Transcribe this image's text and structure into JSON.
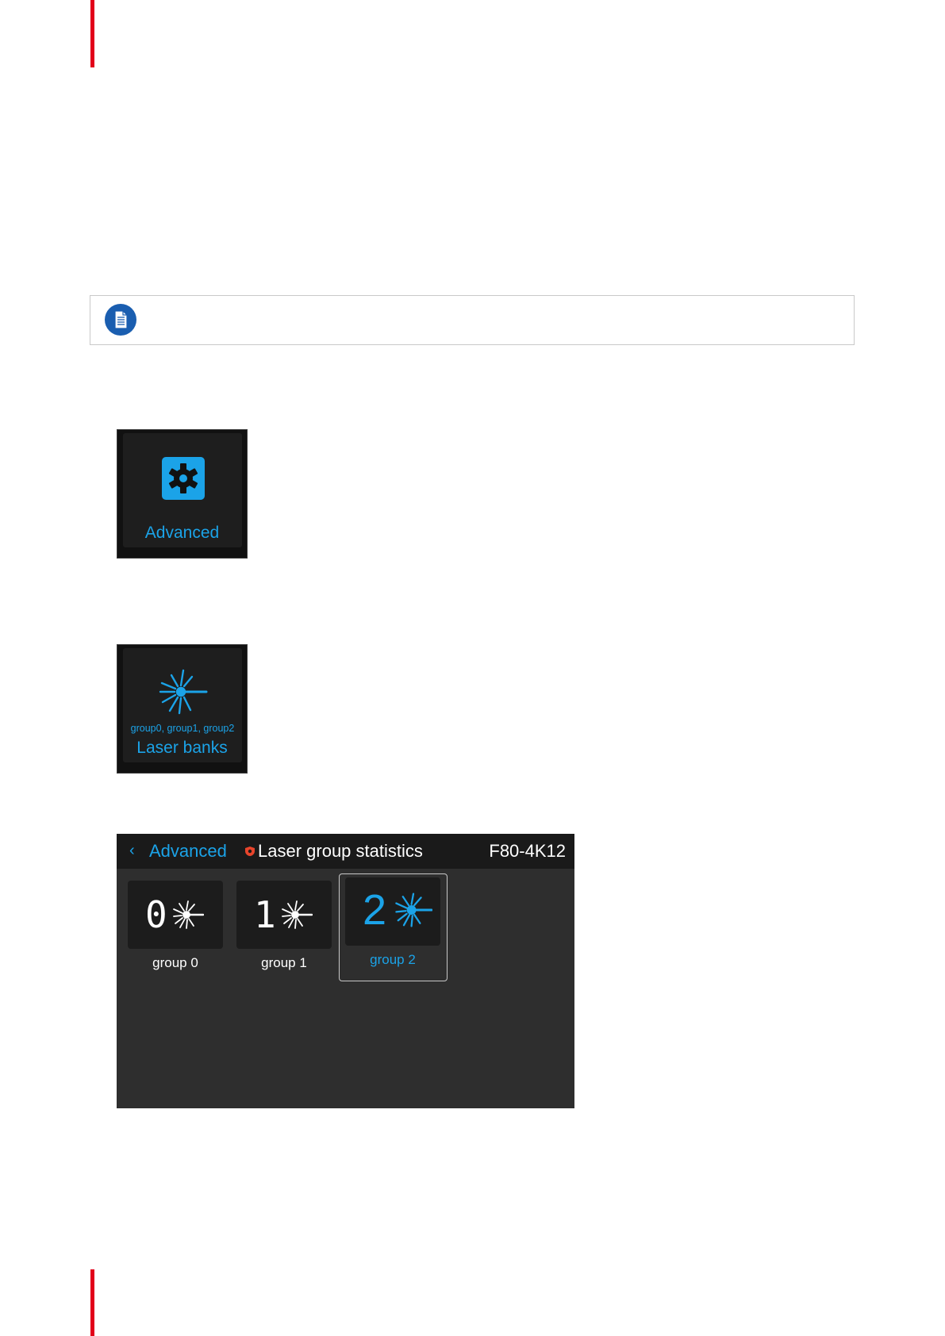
{
  "colors": {
    "accent": "#1ba3e8",
    "brand_red": "#e2001a",
    "note_blue": "#1a5eb0",
    "alert": "#e8452c"
  },
  "note": {
    "icon": "note-document-icon"
  },
  "tiles": {
    "advanced": {
      "label": "Advanced",
      "icon": "gear-icon"
    },
    "laser_banks": {
      "label": "Laser banks",
      "sublabel": "group0, group1, group2",
      "icon": "laser-icon"
    }
  },
  "screen": {
    "back_label": "Advanced",
    "title": "Laser group statistics",
    "model": "F80-4K12",
    "groups": [
      {
        "number": "0",
        "label": "group 0",
        "selected": false
      },
      {
        "number": "1",
        "label": "group 1",
        "selected": false
      },
      {
        "number": "2",
        "label": "group 2",
        "selected": true
      }
    ]
  }
}
